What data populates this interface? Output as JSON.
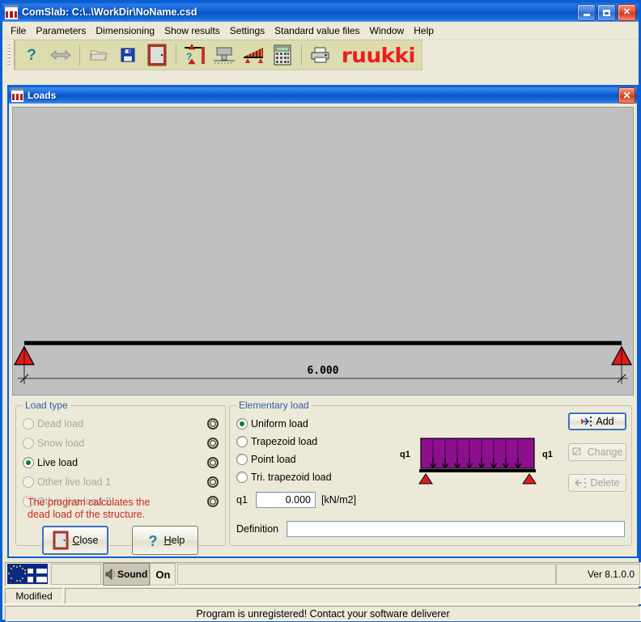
{
  "window": {
    "title": "ComSlab:  C:\\..\\WorkDir\\NoName.csd",
    "icon": "comslab-icon",
    "minimize_label": "Minimize",
    "maximize_label": "Maximize",
    "close_label": "Close"
  },
  "menu": {
    "items": [
      {
        "label": "File"
      },
      {
        "label": "Parameters"
      },
      {
        "label": "Dimensioning"
      },
      {
        "label": "Show results"
      },
      {
        "label": "Settings"
      },
      {
        "label": "Standard value files"
      },
      {
        "label": "Window"
      },
      {
        "label": "Help"
      }
    ]
  },
  "toolbar": {
    "buttons": [
      {
        "name": "help-question-icon",
        "icon": "question-mark"
      },
      {
        "name": "resize-arrows-icon",
        "icon": "left-right-arrows"
      },
      {
        "name": "open-folder-icon",
        "icon": "folder"
      },
      {
        "name": "save-icon",
        "icon": "floppy-disk"
      },
      {
        "name": "slab-section-icon",
        "icon": "slab-section"
      },
      {
        "name": "supports-help-icon",
        "icon": "beam-supports-question"
      },
      {
        "name": "cross-section-icon",
        "icon": "cross-section"
      },
      {
        "name": "loads-icon",
        "icon": "beam-loads"
      },
      {
        "name": "calculator-icon",
        "icon": "calculator"
      },
      {
        "name": "print-icon",
        "icon": "printer"
      }
    ],
    "brand": "ruukki",
    "brand_color": "#ee1c1c"
  },
  "loads_dialog": {
    "title": "Loads",
    "close_label": "✕",
    "beam": {
      "span_label": "6.000",
      "support_color": "#e01b1b"
    },
    "load_type": {
      "legend": "Load type",
      "options": [
        {
          "label": "Dead load",
          "selected": false,
          "enabled": false
        },
        {
          "label": "Snow load",
          "selected": false,
          "enabled": false
        },
        {
          "label": "Live load",
          "selected": true,
          "enabled": true
        },
        {
          "label": "Other live load 1",
          "selected": false,
          "enabled": false
        },
        {
          "label": "Other live load 2",
          "selected": false,
          "enabled": false
        }
      ],
      "settings_icon": "gear-icon",
      "note_line1": "The program calculates the",
      "note_line2": "dead load of the structure.",
      "note_color": "#cc2a1e",
      "close_button": "Close",
      "close_accel": "C",
      "help_button": "Help",
      "help_accel": "H"
    },
    "elementary_load": {
      "legend": "Elementary load",
      "options": [
        {
          "label": "Uniform load",
          "selected": true
        },
        {
          "label": "Trapezoid load",
          "selected": false
        },
        {
          "label": "Point load",
          "selected": false
        },
        {
          "label": "Tri. trapezoid load",
          "selected": false
        }
      ],
      "q1_label": "q1",
      "q1_value": "0.000",
      "q1_unit": "[kN/m2]",
      "definition_label": "Definition",
      "definition_value": "",
      "preview": {
        "left_label": "q1",
        "right_label": "q1",
        "fill_color": "#8e0f8e",
        "support_color": "#e01b1b"
      }
    },
    "actions": [
      {
        "label": "Add",
        "enabled": true,
        "icon": "add-icon"
      },
      {
        "label": "Change",
        "enabled": false,
        "icon": "change-icon"
      },
      {
        "label": "Delete",
        "enabled": false,
        "icon": "delete-icon"
      }
    ]
  },
  "status": {
    "flag_icon": "eu-finland-flag",
    "sound_button": "Sound",
    "sound_state": "On",
    "version": "Ver 8.1.0.0",
    "modified": "Modified",
    "message": "Program is unregistered!  Contact your software deliverer"
  }
}
